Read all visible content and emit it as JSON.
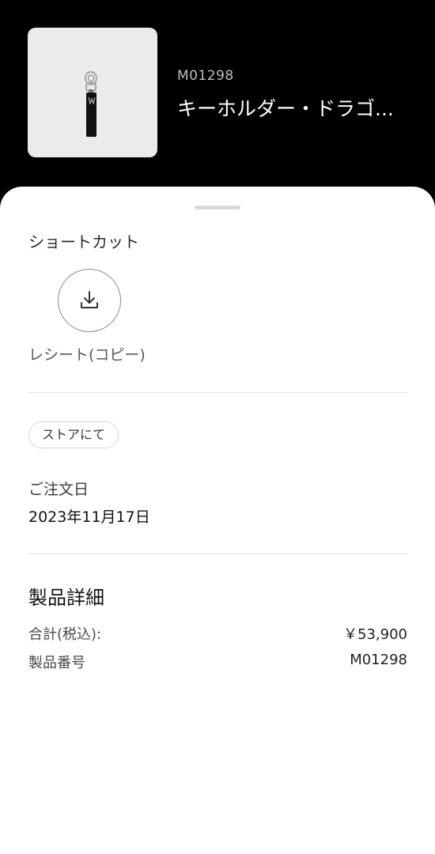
{
  "header": {
    "sku": "M01298",
    "product_name": "キーホルダー・ドラゴ..."
  },
  "shortcuts": {
    "title": "ショートカット",
    "items": [
      {
        "label": "レシート(コピー)",
        "icon": "download-icon"
      }
    ]
  },
  "purchase": {
    "channel_badge": "ストアにて",
    "order_date_label": "ご注文日",
    "order_date_value": "2023年11月17日"
  },
  "details": {
    "title": "製品詳細",
    "rows": [
      {
        "label": "合計(税込):",
        "value": "￥53,900"
      },
      {
        "label": "製品番号",
        "value": "M01298"
      }
    ]
  },
  "colors": {
    "header_bg": "#000000",
    "sheet_bg": "#ffffff",
    "thumb_bg": "#ecebe9"
  }
}
